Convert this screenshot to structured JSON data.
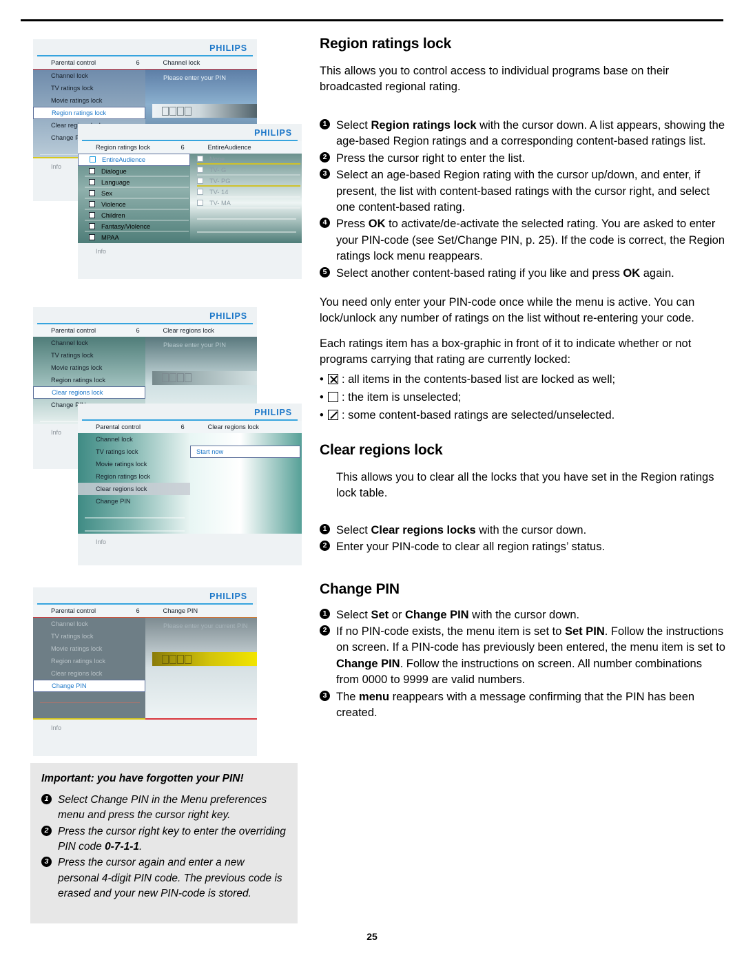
{
  "page": {
    "number": "25"
  },
  "sections": {
    "region": {
      "title": "Region ratings lock",
      "intro": "This allows you to control access to individual programs base on their broadcasted regional rating.",
      "steps": [
        {
          "n": "1",
          "html": "Select <b>Region ratings lock</b> with the cursor down. A list appears, showing the age-based Region ratings and a corresponding content-based ratings list."
        },
        {
          "n": "2",
          "html": "Press the cursor right to enter the list."
        },
        {
          "n": "3",
          "html": "Select an age-based Region rating with the cursor up/down, and enter, if present, the list with content-based ratings with the cursor right, and select one content-based rating."
        },
        {
          "n": "4",
          "html": "Press <b>OK</b> to activate/de-activate the selected rating. You are asked to enter your PIN-code (see Set/Change PIN, p. 25). If the code is correct, the Region ratings lock menu reappears."
        },
        {
          "n": "5",
          "html": "Select another content-based rating if you like and press <b>OK</b> again."
        }
      ],
      "note1": "You need only enter your PIN-code once while the menu is active.  You can lock/unlock any number of ratings on the list without re-entering your code.",
      "note2": "Each ratings item has a box-graphic in front of it to indicate whether or not programs carrying that rating are currently locked:",
      "bullets": [
        {
          "glyph": "x",
          "text": ": all items in the contents-based list are locked as well;"
        },
        {
          "glyph": "empty",
          "text": ": the item is unselected;"
        },
        {
          "glyph": "slash",
          "text": ": some content-based ratings are selected/unselected."
        }
      ]
    },
    "clear": {
      "title": "Clear regions lock",
      "intro": "This allows you to clear all the locks that you have set in the Region ratings lock table.",
      "steps": [
        {
          "n": "1",
          "html": "Select <b>Clear regions locks</b> with the cursor down."
        },
        {
          "n": "2",
          "html": "Enter your PIN-code to clear all region ratings’ status."
        }
      ]
    },
    "changepin": {
      "title": "Change PIN",
      "steps": [
        {
          "n": "1",
          "html": "Select <b>Set</b> or <b>Change PIN</b> with the cursor down."
        },
        {
          "n": "2",
          "html": "If no PIN-code exists, the menu item is set to <b>Set PIN</b>. Follow the instructions on screen. If a PIN-code has previously been entered, the menu item is set to <b>Change PIN</b>. Follow the instructions on screen. All number combinations from 0000 to 9999 are valid numbers."
        },
        {
          "n": "3",
          "html": "The <b>menu</b> reappears with a message confirming that the PIN has been created."
        }
      ]
    }
  },
  "important": {
    "title": "Important: you have forgotten your PIN!",
    "steps": [
      {
        "n": "1",
        "html": "Select Change PIN in the Menu preferences menu and press the cursor right key."
      },
      {
        "n": "2",
        "html": "Press the cursor right key to enter the overriding PIN code <b>0-7-1-1</b>."
      },
      {
        "n": "3",
        "html": "Press the cursor again and enter a new personal 4-digit PIN code. The previous code is erased and your new PIN-code is stored."
      }
    ]
  },
  "tv": {
    "brand": "PHILIPS",
    "info_label": "Info",
    "screen1": {
      "crumb": {
        "left": "Parental control",
        "num": "6",
        "right": "Channel lock"
      },
      "menu": [
        "Channel lock",
        "TV ratings lock",
        "Movie ratings lock",
        "Region ratings lock",
        "Clear regions lock",
        "Change PIN"
      ],
      "selected": "Region ratings lock",
      "prompt": "Please enter your PIN",
      "pin_cells": 4
    },
    "screen2": {
      "crumb": {
        "left": "Region ratings lock",
        "num": "6",
        "right": "EntireAudience"
      },
      "menu": [
        "EntireAudience",
        "Dialogue",
        "Language",
        "Sex",
        "Violence",
        "Children",
        "Fantasy/Violence",
        "MPAA"
      ],
      "selected": "EntireAudience",
      "content": [
        "None",
        "TV- G",
        "TV- PG",
        "TV- 14",
        "TV- MA"
      ]
    },
    "screen3": {
      "crumb": {
        "left": "Parental control",
        "num": "6",
        "right": "Clear regions lock"
      },
      "menu": [
        "Channel lock",
        "TV ratings lock",
        "Movie ratings lock",
        "Region ratings lock",
        "Clear regions lock",
        "Change PIN"
      ],
      "selected": "Clear regions lock",
      "prompt": "Please enter your PIN",
      "pin_cells": 4
    },
    "screen4": {
      "crumb": {
        "left": "Parental control",
        "num": "6",
        "right": "Clear regions lock"
      },
      "menu": [
        "Channel lock",
        "TV ratings lock",
        "Movie ratings lock",
        "Region ratings lock",
        "Clear regions lock",
        "Change PIN"
      ],
      "highlighted": "Clear regions lock",
      "action": "Start now"
    },
    "screen5": {
      "crumb": {
        "left": "Parental control",
        "num": "6",
        "right": "Change PIN"
      },
      "menu": [
        "Channel lock",
        "TV ratings lock",
        "Movie ratings lock",
        "Region ratings lock",
        "Clear regions lock",
        "Change PIN"
      ],
      "selected": "Change PIN",
      "prompt": "Please enter your current PIN",
      "pin_cells": 4
    }
  }
}
